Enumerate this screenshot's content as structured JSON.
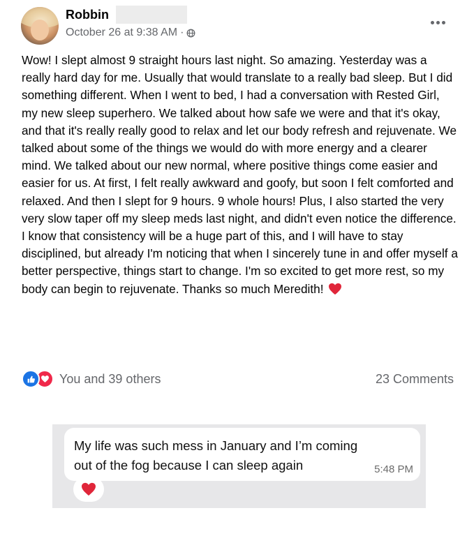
{
  "post": {
    "author_name": "Robbin",
    "timestamp": "October 26 at 9:38 AM",
    "separator": "·",
    "audience_icon": "globe-icon",
    "more_icon": "more-options-icon",
    "body_text": "Wow! I slept almost 9 straight hours last night.  So amazing. Yesterday was a really hard day for me. Usually that would translate to a really bad sleep.  But I did something different. When I went to bed, I had a conversation with Rested Girl, my new sleep superhero. We talked about how safe we were and that it's okay, and that it's really really good to relax and let our body refresh and rejuvenate. We talked about some of the things we would do with more energy and a clearer mind.  We talked about our new normal, where positive things come easier and easier for us. At first, I felt really awkward and goofy, but soon I felt comforted and relaxed.  And then I slept for 9 hours. 9 whole hours!  Plus, I also started the very very slow taper off my sleep meds last night, and didn't even notice the difference.  I know that consistency will be a huge part of this, and I will have to stay disciplined, but already I'm noticing that when I sincerely tune in and offer myself a better perspective, things start to change.  I'm so excited to get more rest, so my body can begin to rejuvenate. Thanks so much Meredith!",
    "body_end_emoji": "red-heart-icon"
  },
  "engagement": {
    "reaction_icons": [
      "like-icon",
      "love-icon"
    ],
    "reactions_label": "You and 39 others",
    "comments_label": "23 Comments"
  },
  "message": {
    "text": "My life was such mess in January and I’m coming out of the fog because I can sleep again",
    "time": "5:48 PM",
    "reaction_icon": "red-heart-icon"
  },
  "colors": {
    "like_blue": "#1b74e4",
    "love_red": "#f0284a",
    "heart_red": "#e0263a",
    "meta_gray": "#65676b",
    "message_bg": "#e7e7e9"
  }
}
